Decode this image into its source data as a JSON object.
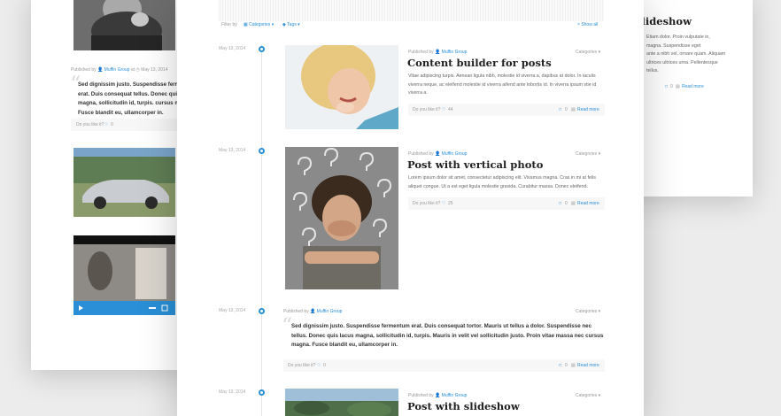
{
  "left_card": {
    "meta": {
      "published_by": "Published by",
      "author": "Muffin Group",
      "at": "at",
      "date": "May 13, 2014"
    },
    "quote": "Sed dignissim justo. Suspendisse fermentum erat. Duis consequat tellus. Donec quis lacus magna, sollicitudin id, turpis. cursus magna. Fusce blandit eu, ullamcorper in.",
    "like_label": "Do you like it?",
    "like_count": "0"
  },
  "right_card": {
    "title": "slideshow",
    "lines": [
      "Etiam dolor. Proin vulputate in,",
      "magna. Suspendisse eget",
      "ante a nibh vel, ornare quam. Aliquam",
      "ultrices ultrices urna. Pellentesque",
      "tellus."
    ],
    "comment_count": "0",
    "read_more": "Read more"
  },
  "filter": {
    "label": "Filter by",
    "categories": "Categories",
    "tags": "Tags",
    "show_all": "Show all"
  },
  "posts": [
    {
      "date": "May 13, 2014",
      "published_by": "Published by",
      "author": "Muffin Group",
      "categories": "Categories",
      "title": "Content builder for posts",
      "excerpt": "Vitae adipiscing turpis. Aenean ligula nibh, molestie id viverra a, dapibus at dolor. In iaculis viverra neque, ac eleifend molestie id viverra aifend ante lobortis id. In viverra ipsum stie id viverra a.",
      "like_label": "Do you like it?",
      "likes": "44",
      "comments": "0",
      "read_more": "Read more"
    },
    {
      "date": "May 13, 2014",
      "published_by": "Published by",
      "author": "Muffin Group",
      "categories": "Categories",
      "title": "Post with vertical photo",
      "excerpt": "Lorem ipsum dolor sit amet, consectetur adipiscing elit. Vivamus magna. Cras in mi at felis aliquet congue. Ut a est eget ligula molestie gravida. Curabitur massa. Donec eleifend.",
      "like_label": "Do you like it?",
      "likes": "25",
      "comments": "0",
      "read_more": "Read more"
    },
    {
      "date": "May 13, 2014",
      "published_by": "Published by",
      "author": "Muffin Group",
      "categories": "Categories",
      "quote": "Sed dignissim justo. Suspendisse fermentum erat. Duis consequat tortor. Mauris ut tellus a dolor. Suspendisse nec tellus. Donec quis lacus magna, sollicitudin id, turpis. Mauris in velit vel sollicitudin justo. Proin vitae massa nec cursus magna. Fusce blandit eu, ullamcorper in.",
      "like_label": "Do you like it?",
      "likes": "0",
      "comments": "0",
      "read_more": "Read more"
    },
    {
      "date": "May 13, 2014",
      "published_by": "Published by",
      "author": "Muffin Group",
      "categories": "Categories",
      "title": "Post with slideshow"
    }
  ],
  "colors": {
    "accent": "#2a8fd6",
    "title": "#222222",
    "text": "#666666"
  }
}
